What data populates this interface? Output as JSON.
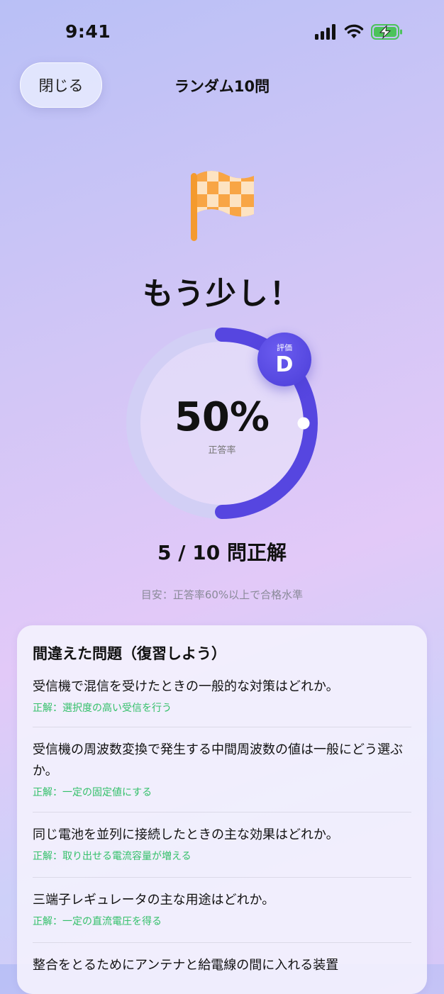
{
  "status": {
    "time": "9:41"
  },
  "nav": {
    "close_label": "閉じる",
    "title": "ランダム10問"
  },
  "result": {
    "headline": "もう少し！",
    "percent": "50%",
    "percent_value": 0.5,
    "percent_label": "正答率",
    "grade_label": "評価",
    "grade": "D",
    "score": "5 / 10 問正解",
    "hint": "目安：正答率60%以上で合格水準"
  },
  "colors": {
    "accent": "#5646e0",
    "correct": "#34c06a",
    "flag": "#f7a23b"
  },
  "review": {
    "title": "間違えた問題（復習しよう）",
    "items": [
      {
        "question": "受信機で混信を受けたときの一般的な対策はどれか。",
        "answer": "正解：選択度の高い受信を行う"
      },
      {
        "question": "受信機の周波数変換で発生する中間周波数の値は一般にどう選ぶか。",
        "answer": "正解：一定の固定値にする"
      },
      {
        "question": "同じ電池を並列に接続したときの主な効果はどれか。",
        "answer": "正解：取り出せる電流容量が増える"
      },
      {
        "question": "三端子レギュレータの主な用途はどれか。",
        "answer": "正解：一定の直流電圧を得る"
      },
      {
        "question": "整合をとるためにアンテナと給電線の間に入れる装置",
        "answer": ""
      }
    ]
  }
}
